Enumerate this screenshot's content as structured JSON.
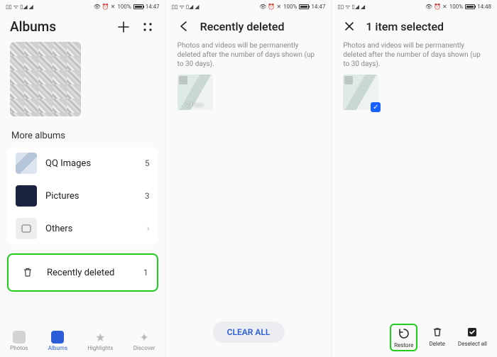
{
  "status": {
    "left_text": "▯▯ ᯤ ▯◢ ◢",
    "icons_text": "👁 ⏰ ✕",
    "battery_pct": "100%",
    "time_a": "14:47",
    "time_b": "14:48"
  },
  "screen1": {
    "title": "Albums",
    "more_albums_label": "More albums",
    "albums": [
      {
        "name": "QQ Images",
        "count": "5"
      },
      {
        "name": "Pictures",
        "count": "3"
      },
      {
        "name": "Others",
        "count": "›"
      }
    ],
    "recently_deleted": {
      "name": "Recently deleted",
      "count": "1"
    },
    "nav": {
      "photos": "Photos",
      "albums": "Albums",
      "highlights": "Highlights",
      "discover": "Discover"
    }
  },
  "screen2": {
    "title": "Recently deleted",
    "info": "Photos and videos will be permanently deleted after the number of days shown (up to 30 days).",
    "thumb_label": "29 days",
    "clear_all": "CLEAR ALL"
  },
  "screen3": {
    "title": "1 item selected",
    "info": "Photos and videos will be permanently deleted after the number of days shown (up to 30 days).",
    "actions": {
      "restore": "Restore",
      "delete": "Delete",
      "deselect": "Deselect all"
    }
  }
}
